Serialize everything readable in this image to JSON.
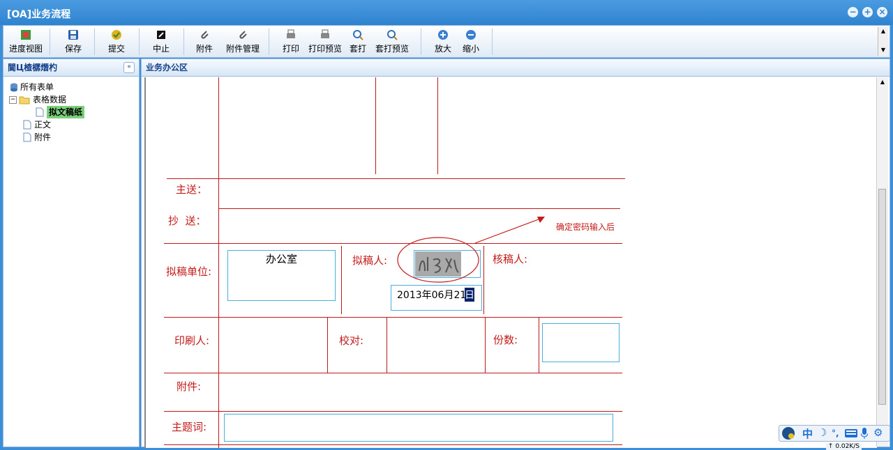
{
  "window": {
    "title": "[OA]业务流程"
  },
  "toolbar": {
    "progress": "进度视图",
    "save": "保存",
    "submit": "提交",
    "stop": "中止",
    "attachment": "附件",
    "attachment_manage": "附件管理",
    "print": "打印",
    "print_preview": "打印预览",
    "overlay_print": "套打",
    "overlay_preview": "套打预览",
    "zoom_in": "放大",
    "zoom_out": "缩小"
  },
  "left_panel": {
    "title": "閫Ц楂樼熸杓",
    "tree": {
      "root": "所有表单",
      "folder": "表格数据",
      "selected": "拟文稿纸",
      "item_body": "正文",
      "item_attach": "附件"
    }
  },
  "right_panel": {
    "title": "业务办公区"
  },
  "form": {
    "main_send": "主送：",
    "cc": "抄  送：",
    "draft_unit": "拟稿单位:",
    "draft_unit_value": "办公室",
    "drafter": "拟稿人:",
    "date_prefix": "2013年06月21",
    "date_suffix": "日",
    "checker": "核稿人:",
    "printer": "印刷人:",
    "proofread": "校对:",
    "copies": "份数:",
    "attachments": "附件:",
    "keywords": "主题词:",
    "annotation": "确定密码输入后"
  },
  "status": {
    "ime_char": "中",
    "speed": "0.02K/S"
  }
}
